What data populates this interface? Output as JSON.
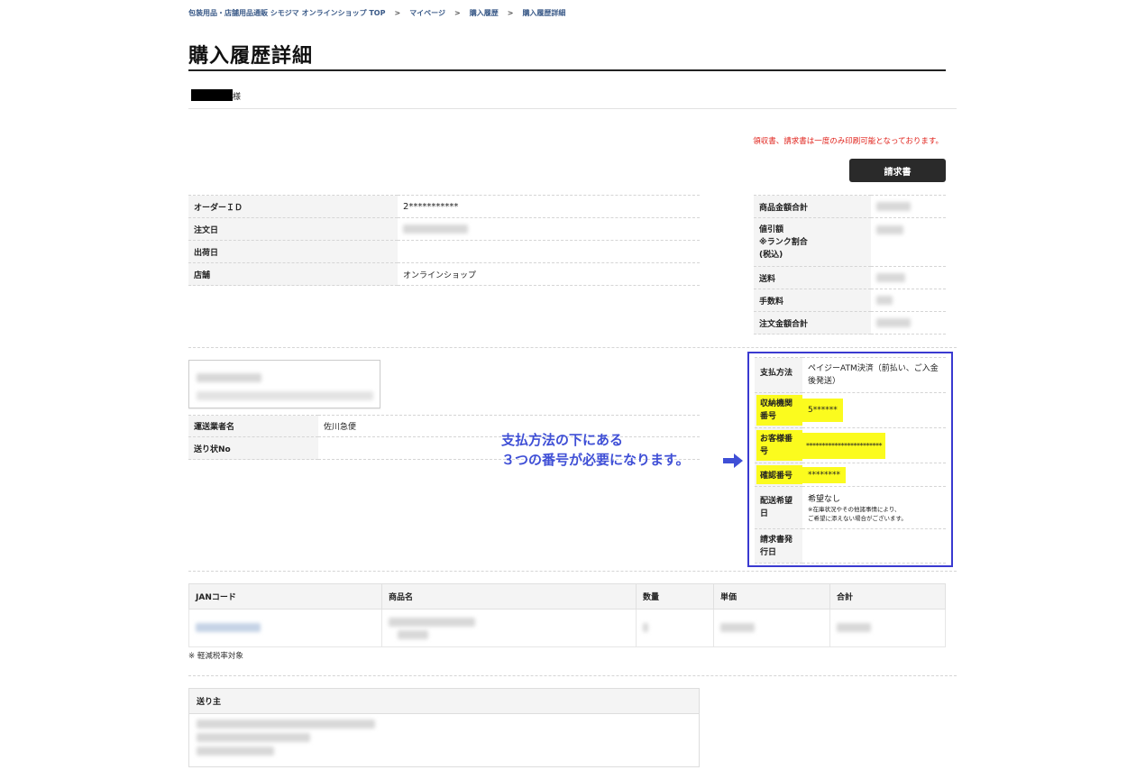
{
  "breadcrumb": {
    "items": [
      "包装用品・店舗用品通販 シモジマ オンラインショップ TOP",
      "マイページ",
      "購入履歴",
      "購入履歴詳細"
    ],
    "separator": ">"
  },
  "page_title": "購入履歴詳細",
  "customer": {
    "suffix": "様"
  },
  "notice": "領収書、請求書は一度のみ印刷可能となっております。",
  "invoice_button": "請求書",
  "order_info": {
    "order_id_label": "オーダーＩＤ",
    "order_id_value": "2***********",
    "order_date_label": "注文日",
    "ship_date_label": "出荷日",
    "store_label": "店舗",
    "store_value": "オンラインショップ"
  },
  "totals": {
    "subtotal_label": "商品金額合計",
    "discount_label_1": "値引額",
    "discount_label_2": "※ランク割合",
    "discount_label_3": "(税込)",
    "shipping_label": "送料",
    "fee_label": "手数料",
    "total_label": "注文金額合計"
  },
  "shipping": {
    "carrier_label": "運送業者名",
    "carrier_value": "佐川急便",
    "tracking_label": "送り状No"
  },
  "payment": {
    "method_label": "支払方法",
    "method_value": "ペイジーATM決済（前払い、ご入金後発送）",
    "institution_label": "収納機関番号",
    "institution_value": "5******",
    "customer_no_label": "お客様番号",
    "customer_no_value": "************************",
    "confirm_label": "確認番号",
    "confirm_value": "********",
    "delivery_label": "配送希望日",
    "delivery_value": "希望なし",
    "delivery_note_1": "※在庫状況やその他諸事情により、",
    "delivery_note_2": "ご希望に添えない場合がございます。",
    "invoice_date_label": "請求書発行日"
  },
  "annotation": {
    "line1": "支払方法の下にある",
    "line2": "３つの番号が必要になります。"
  },
  "items_table": {
    "headers": [
      "JANコード",
      "商品名",
      "数量",
      "単価",
      "合計"
    ]
  },
  "footnote": "※ 軽減税率対象",
  "sender": {
    "header": "送り主"
  },
  "colors": {
    "accent": "#3a3ad0",
    "highlight": "#fbfb1e",
    "notice": "#e0211a",
    "breadcrumb": "#3a5a88"
  }
}
